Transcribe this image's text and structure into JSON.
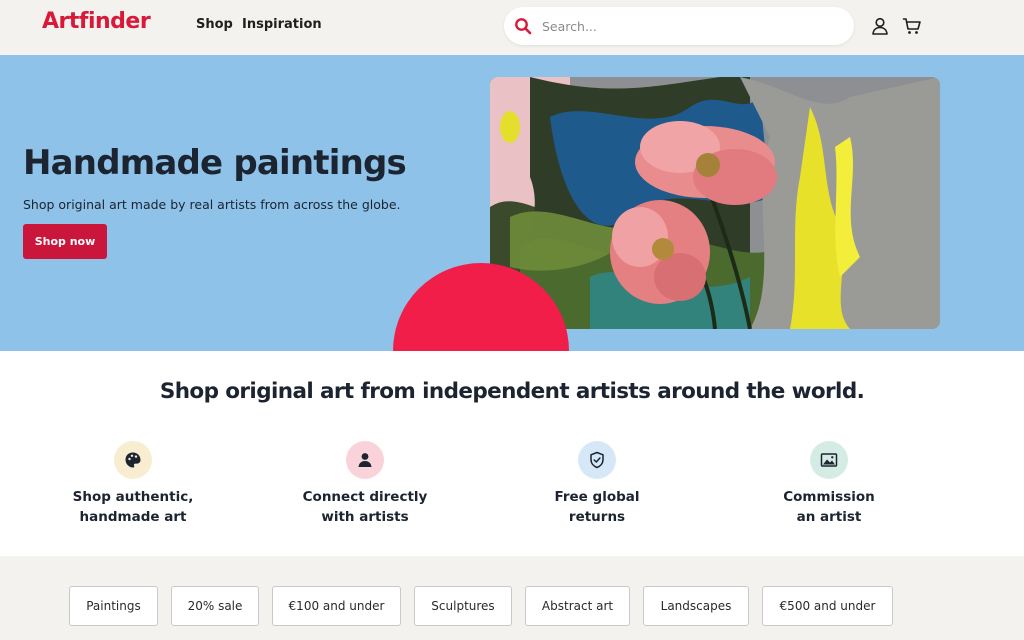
{
  "header": {
    "logo": "Artfinder",
    "nav": [
      "Shop",
      "Inspiration"
    ],
    "search_placeholder": "Search...",
    "brand_color": "#d8193a"
  },
  "hero": {
    "title": "Handmade paintings",
    "subtitle": "Shop original art made by real artists from across the globe.",
    "cta_label": "Shop now",
    "background_color": "#8ec2e8",
    "accent_color": "#f01e48"
  },
  "features": {
    "heading": "Shop original art from independent artists around the world.",
    "items": [
      {
        "label": "Shop authentic,\nhandmade art",
        "icon": "palette-icon",
        "bg": "#f8edd0"
      },
      {
        "label": "Connect directly\nwith artists",
        "icon": "person-icon",
        "bg": "#f9d3d9"
      },
      {
        "label": "Free global\nreturns",
        "icon": "shield-icon",
        "bg": "#d6e8f7"
      },
      {
        "label": "Commission\nan artist",
        "icon": "image-icon",
        "bg": "#d5ece5"
      }
    ]
  },
  "categories": [
    "Paintings",
    "20% sale",
    "€100 and under",
    "Sculptures",
    "Abstract art",
    "Landscapes",
    "€500 and under"
  ]
}
